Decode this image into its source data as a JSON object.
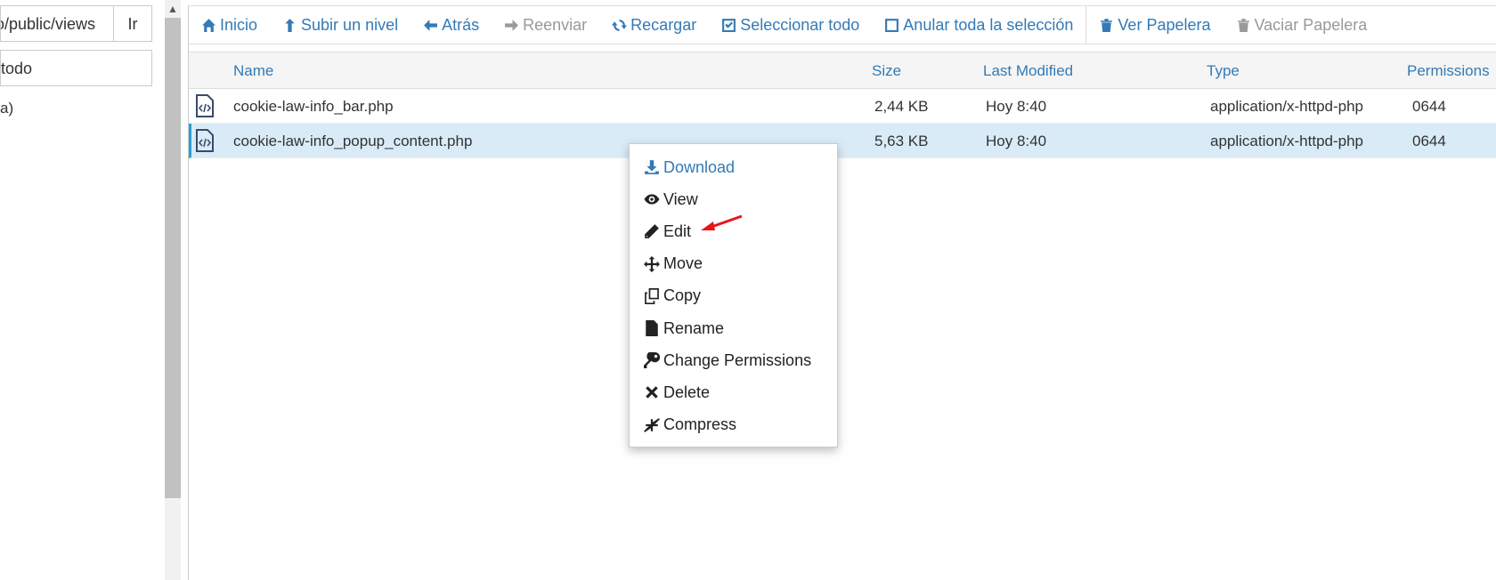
{
  "sidebar": {
    "path_value": "o/public/views",
    "go_label": "Ir",
    "filter_value": "todo",
    "tree_item": "a)"
  },
  "toolbar": {
    "home": "Inicio",
    "up_level": "Subir un nivel",
    "back": "Atrás",
    "forward": "Reenviar",
    "reload": "Recargar",
    "select_all": "Seleccionar todo",
    "deselect_all": "Anular toda la selección",
    "view_trash": "Ver Papelera",
    "empty_trash": "Vaciar Papelera"
  },
  "table": {
    "headers": {
      "name": "Name",
      "size": "Size",
      "modified": "Last Modified",
      "type": "Type",
      "permissions": "Permissions"
    },
    "rows": [
      {
        "name": "cookie-law-info_bar.php",
        "size": "2,44 KB",
        "modified": "Hoy 8:40",
        "type": "application/x-httpd-php",
        "perms": "0644"
      },
      {
        "name": "cookie-law-info_popup_content.php",
        "size": "5,63 KB",
        "modified": "Hoy 8:40",
        "type": "application/x-httpd-php",
        "perms": "0644"
      }
    ]
  },
  "context_menu": {
    "items": [
      "Download",
      "View",
      "Edit",
      "Move",
      "Copy",
      "Rename",
      "Change Permissions",
      "Delete",
      "Compress"
    ]
  },
  "colors": {
    "link": "#337ab7",
    "selected_row": "#d9ebf7",
    "annotation_arrow": "#e8141b"
  }
}
